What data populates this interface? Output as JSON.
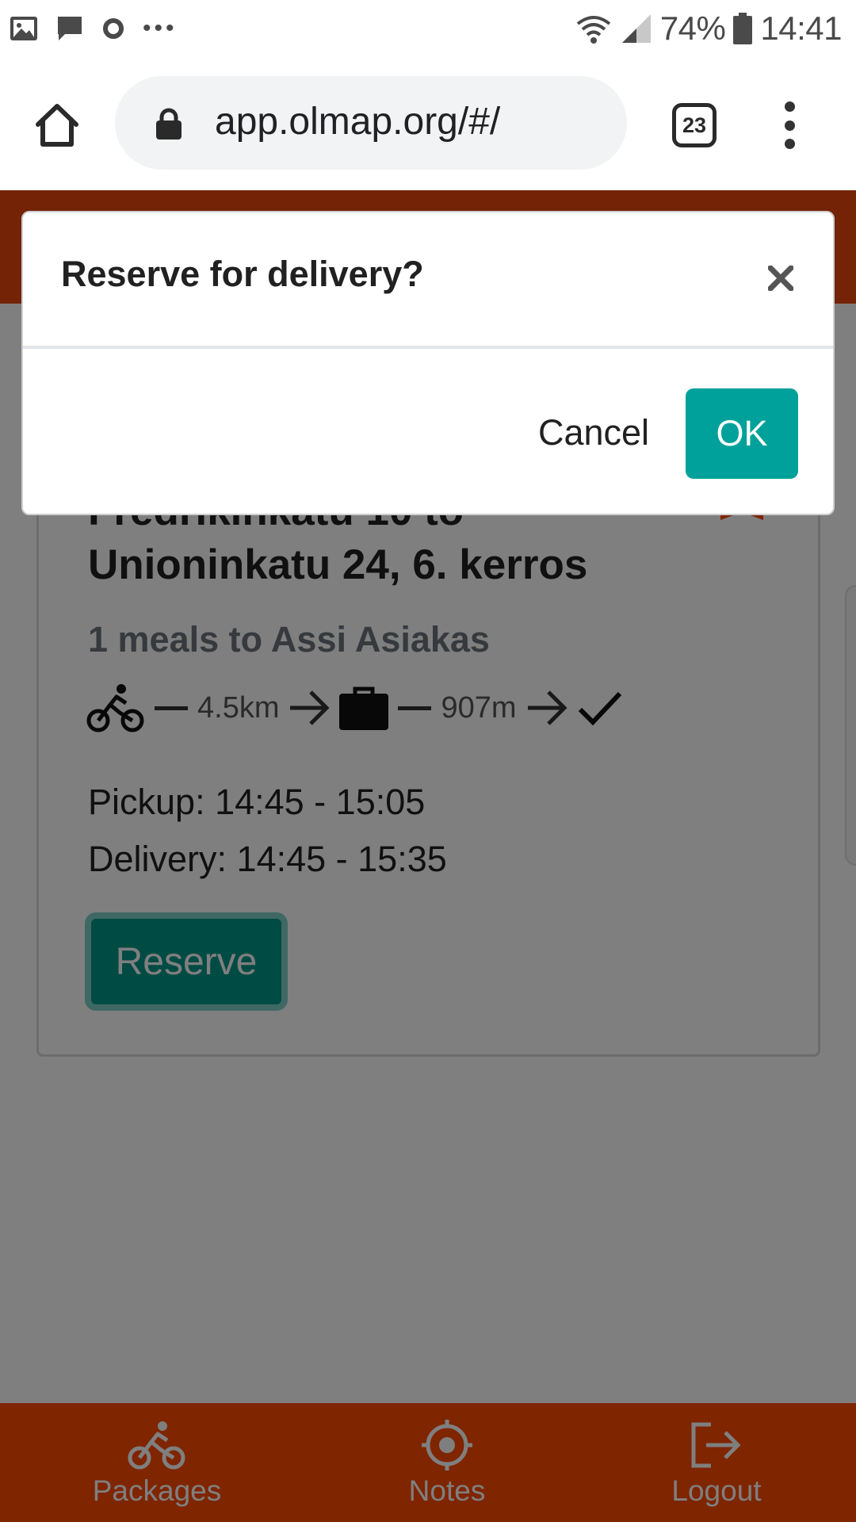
{
  "status_bar": {
    "notification_icons": [
      "image-icon",
      "message-icon",
      "circle-icon",
      "more-icon"
    ],
    "battery": "74%",
    "time": "14:41"
  },
  "browser": {
    "url": "app.olmap.org/#/",
    "tab_count": "23"
  },
  "card": {
    "title_line1": "Fredrikinkatu 10 to",
    "title_line2": "Unioninkatu 24, 6. kerros",
    "subtitle": "1 meals to Assi Asiakas",
    "route": {
      "leg1_distance": "4.5km",
      "leg2_distance": "907m"
    },
    "pickup": "Pickup: 14:45 - 15:05",
    "delivery": "Delivery: 14:45 - 15:35",
    "reserve_label": "Reserve"
  },
  "bottom_nav": {
    "items": [
      {
        "label": "Packages",
        "icon": "bicycle-icon"
      },
      {
        "label": "Notes",
        "icon": "crosshair-icon"
      },
      {
        "label": "Logout",
        "icon": "logout-icon"
      }
    ]
  },
  "modal": {
    "title": "Reserve for delivery?",
    "cancel_label": "Cancel",
    "ok_label": "OK"
  },
  "colors": {
    "brand_orange": "#ff4a00",
    "teal": "#00a19a",
    "overlay": "rgba(0,0,0,0.5)"
  }
}
